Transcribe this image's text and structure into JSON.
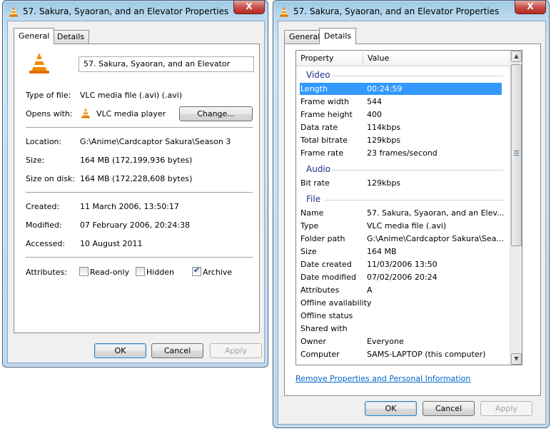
{
  "left_window": {
    "title": "57. Sakura, Syaoran, and an Elevator Properties",
    "close_label": "X",
    "tabs": [
      "General",
      "Details"
    ],
    "file_name": "57. Sakura, Syaoran, and an Elevator",
    "type_label": "Type of file:",
    "type_value": "VLC media file (.avi) (.avi)",
    "opens_label": "Opens with:",
    "opens_value": "VLC media player",
    "change_label": "Change...",
    "location_label": "Location:",
    "location_value": "G:\\Anime\\Cardcaptor Sakura\\Season 3",
    "size_label": "Size:",
    "size_value": "164 MB (172,199,936 bytes)",
    "size_disk_label": "Size on disk:",
    "size_disk_value": "164 MB (172,228,608 bytes)",
    "created_label": "Created:",
    "created_value": "11 March 2006, 13:50:17",
    "modified_label": "Modified:",
    "modified_value": "07 February 2006, 20:24:38",
    "accessed_label": "Accessed:",
    "accessed_value": "10 August 2011",
    "attributes_label": "Attributes:",
    "readonly_label": "Read-only",
    "hidden_label": "Hidden",
    "archive_label": "Archive",
    "ok": "OK",
    "cancel": "Cancel",
    "apply": "Apply"
  },
  "right_window": {
    "title": "57. Sakura, Syaoran, and an Elevator Properties",
    "close_label": "X",
    "tabs": [
      "General",
      "Details"
    ],
    "col_property": "Property",
    "col_value": "Value",
    "group_video": "Video",
    "video_rows": [
      {
        "p": "Length",
        "v": "00:24:59"
      },
      {
        "p": "Frame width",
        "v": "544"
      },
      {
        "p": "Frame height",
        "v": "400"
      },
      {
        "p": "Data rate",
        "v": "114kbps"
      },
      {
        "p": "Total bitrate",
        "v": "129kbps"
      },
      {
        "p": "Frame rate",
        "v": "23 frames/second"
      }
    ],
    "group_audio": "Audio",
    "audio_rows": [
      {
        "p": "Bit rate",
        "v": "129kbps"
      }
    ],
    "group_file": "File",
    "file_rows": [
      {
        "p": "Name",
        "v": "57. Sakura, Syaoran, and an Elev..."
      },
      {
        "p": "Type",
        "v": "VLC media file (.avi)"
      },
      {
        "p": "Folder path",
        "v": "G:\\Anime\\Cardcaptor Sakura\\Sea..."
      },
      {
        "p": "Size",
        "v": "164 MB"
      },
      {
        "p": "Date created",
        "v": "11/03/2006 13:50"
      },
      {
        "p": "Date modified",
        "v": "07/02/2006 20:24"
      },
      {
        "p": "Attributes",
        "v": "A"
      },
      {
        "p": "Offline availability",
        "v": ""
      },
      {
        "p": "Offline status",
        "v": ""
      },
      {
        "p": "Shared with",
        "v": ""
      },
      {
        "p": "Owner",
        "v": "Everyone"
      },
      {
        "p": "Computer",
        "v": "SAMS-LAPTOP (this computer)"
      }
    ],
    "remove_link": "Remove Properties and Personal Information",
    "ok": "OK",
    "cancel": "Cancel",
    "apply": "Apply"
  }
}
